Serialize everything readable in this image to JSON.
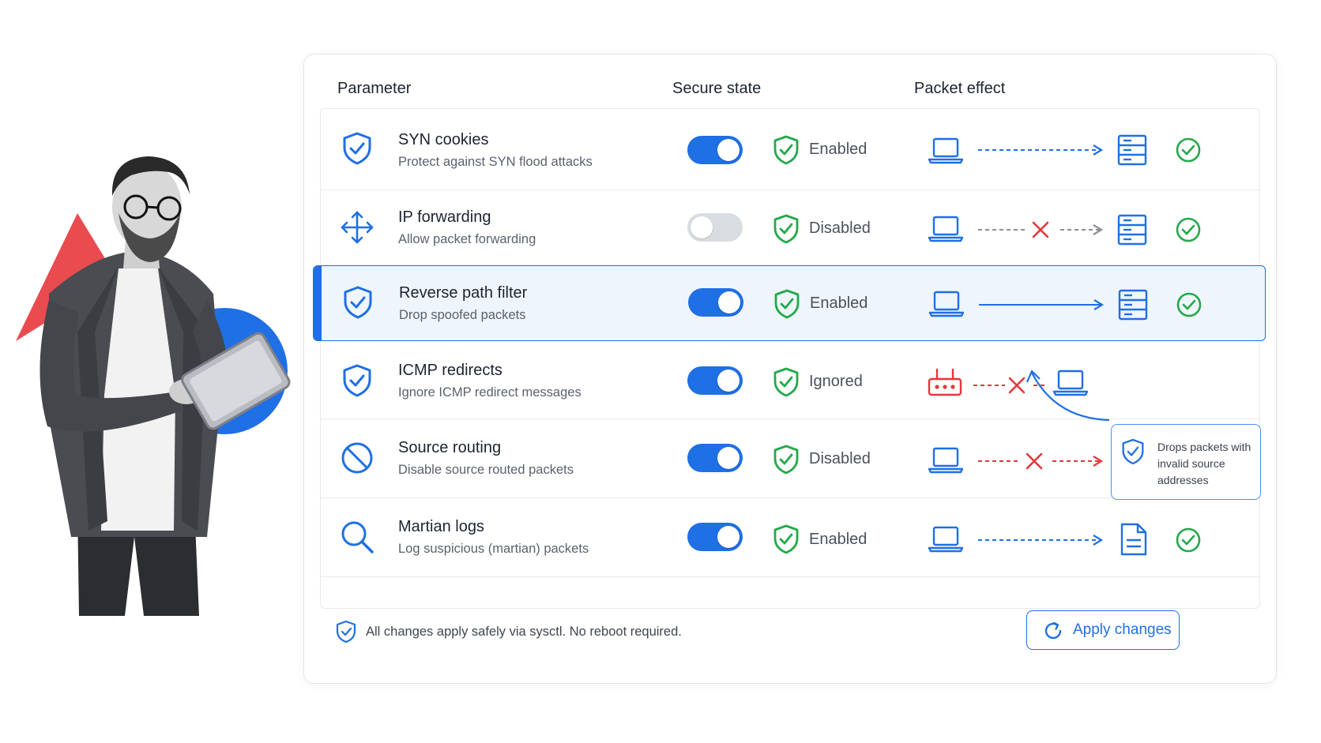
{
  "headers": {
    "parameter": "Parameter",
    "secure_state": "Secure state",
    "packet_effect": "Packet effect"
  },
  "rows": [
    {
      "title": "SYN cookies",
      "desc": "Protect against SYN flood attacks",
      "toggle_on": true,
      "state": "Enabled",
      "icon": "shield-check-icon",
      "flow": "allowed-dashed-to-server"
    },
    {
      "title": "IP forwarding",
      "desc": "Allow packet forwarding",
      "toggle_on": false,
      "state": "Disabled",
      "icon": "move-arrows-icon",
      "flow": "blocked-gray-to-server"
    },
    {
      "title": "Reverse path filter",
      "desc": "Drop spoofed packets",
      "toggle_on": true,
      "state": "Enabled",
      "icon": "shield-check-icon",
      "flow": "allowed-solid-to-server",
      "highlighted": true
    },
    {
      "title": "ICMP redirects",
      "desc": "Ignore ICMP redirect messages",
      "toggle_on": true,
      "state": "Ignored",
      "icon": "shield-check-icon",
      "flow": "router-blocked-to-laptop"
    },
    {
      "title": "Source routing",
      "desc": "Disable source routed packets",
      "toggle_on": true,
      "state": "Disabled",
      "icon": "prohibited-icon",
      "flow": "blocked-red-to-server"
    },
    {
      "title": "Martian logs",
      "desc": "Log suspicious (martian) packets",
      "toggle_on": true,
      "state": "Enabled",
      "icon": "search-icon",
      "flow": "allowed-dashed-to-log"
    }
  ],
  "callout": {
    "text": "Drops packets with invalid source addresses"
  },
  "footer": {
    "note": "All changes apply safely via sysctl. No reboot required.",
    "apply_label": "Apply changes"
  },
  "colors": {
    "accent": "#1f6fe5",
    "success": "#22a94a",
    "danger": "#e5363b",
    "muted": "#8a8f98",
    "highlight_bg": "#eff5fd"
  }
}
